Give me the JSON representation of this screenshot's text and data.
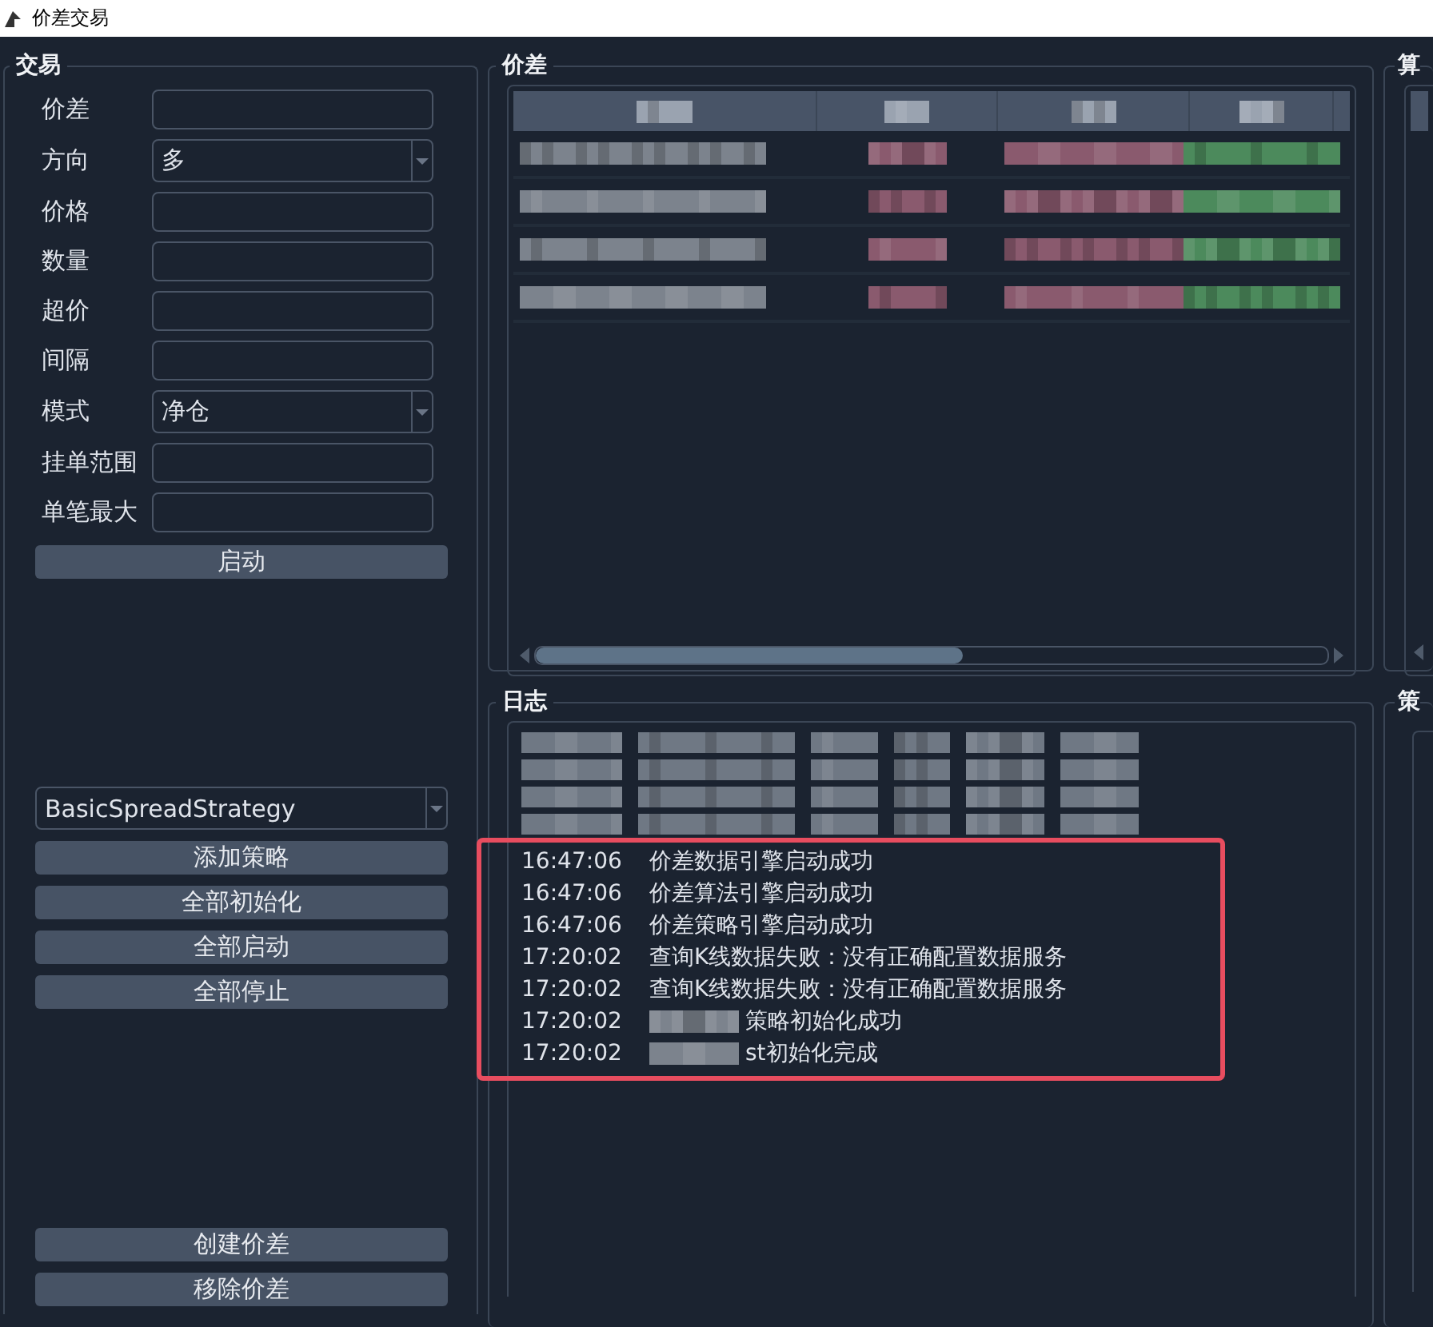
{
  "window": {
    "title": "价差交易"
  },
  "trade": {
    "title": "交易",
    "fields": [
      {
        "label": "价差",
        "kind": "text"
      },
      {
        "label": "方向",
        "kind": "select",
        "value": "多"
      },
      {
        "label": "价格",
        "kind": "text"
      },
      {
        "label": "数量",
        "kind": "text"
      },
      {
        "label": "超价",
        "kind": "text"
      },
      {
        "label": "间隔",
        "kind": "text"
      },
      {
        "label": "模式",
        "kind": "select",
        "value": "净仓"
      },
      {
        "label": "挂单范围",
        "kind": "text"
      },
      {
        "label": "单笔最大",
        "kind": "text"
      }
    ],
    "start_button": "启动",
    "strategy_select": "BasicSpreadStrategy",
    "strategy_buttons": [
      "添加策略",
      "全部初始化",
      "全部启动",
      "全部停止"
    ],
    "spread_buttons": [
      "创建价差",
      "移除价差"
    ]
  },
  "spread": {
    "title": "价差",
    "columns": [
      {
        "pixelated": true
      },
      {
        "pixelated": true
      },
      {
        "pixelated": true
      },
      {
        "pixelated": true
      }
    ],
    "rows": [
      {
        "cells": [
          {
            "color": "#7c838d"
          },
          {
            "color": "#8a5a6e"
          },
          {
            "color": "#8a5a6e"
          },
          {
            "color": "#4c8a5c"
          }
        ]
      },
      {
        "cells": [
          {
            "color": "#7c838d"
          },
          {
            "color": "#8a5a6e"
          },
          {
            "color": "#8a5a6e"
          },
          {
            "color": "#4c8a5c"
          }
        ]
      },
      {
        "cells": [
          {
            "color": "#7c838d"
          },
          {
            "color": "#8a5a6e"
          },
          {
            "color": "#8a5a6e"
          },
          {
            "color": "#4c8a5c"
          }
        ]
      },
      {
        "cells": [
          {
            "color": "#7c838d"
          },
          {
            "color": "#8a5a6e"
          },
          {
            "color": "#8a5a6e"
          },
          {
            "color": "#4c8a5c"
          }
        ]
      }
    ]
  },
  "log": {
    "title": "日志",
    "entries": [
      {
        "kind": "pixelated"
      },
      {
        "kind": "pixelated"
      },
      {
        "kind": "pixelated"
      },
      {
        "kind": "pixelated"
      }
    ],
    "highlighted_entries": [
      {
        "kind": "text",
        "time": "16:47:06",
        "message": "价差数据引擎启动成功"
      },
      {
        "kind": "text",
        "time": "16:47:06",
        "message": "价差算法引擎启动成功"
      },
      {
        "kind": "text",
        "time": "16:47:06",
        "message": "价差策略引擎启动成功"
      },
      {
        "kind": "text",
        "time": "17:20:02",
        "message": "查询K线数据失败：没有正确配置数据服务"
      },
      {
        "kind": "text",
        "time": "17:20:02",
        "message": "查询K线数据失败：没有正确配置数据服务"
      },
      {
        "kind": "partly_pixelated",
        "time": "17:20:02",
        "message": "策略初始化成功"
      },
      {
        "kind": "partly_pixelated",
        "time": "17:20:02",
        "message": "st初始化完成"
      }
    ]
  },
  "algo": {
    "title": "算"
  },
  "strategy": {
    "title": "策"
  }
}
